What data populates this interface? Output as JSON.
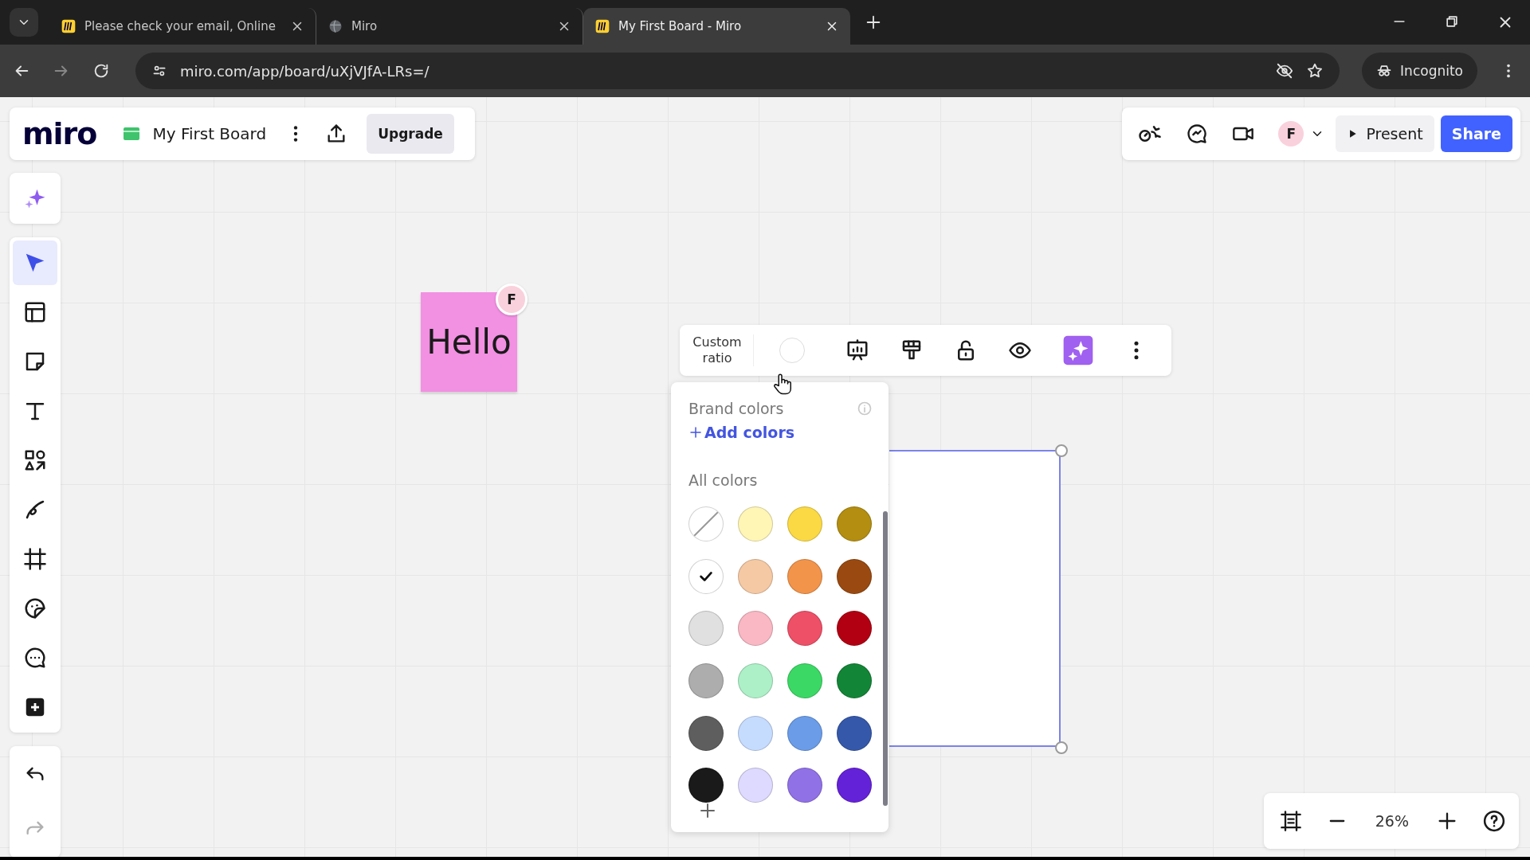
{
  "browser": {
    "tabs": [
      {
        "title": "Please check your email, Online",
        "kind": "miro",
        "selected": false
      },
      {
        "title": "Miro",
        "kind": "globe",
        "selected": false
      },
      {
        "title": "My First Board - Miro",
        "kind": "miro",
        "selected": true
      }
    ],
    "url": "miro.com/app/board/uXjVJfA-LRs=/",
    "profile": "Incognito"
  },
  "board_bar": {
    "logo": "miro",
    "title": "My First Board",
    "upgrade": "Upgrade"
  },
  "collab_bar": {
    "avatar": "F",
    "present": "Present",
    "share": "Share"
  },
  "tools": [
    {
      "kind": "select",
      "selected": true
    },
    {
      "kind": "templates",
      "selected": false
    },
    {
      "kind": "sticky",
      "selected": false
    },
    {
      "kind": "text",
      "selected": false
    },
    {
      "kind": "shapes",
      "selected": false
    },
    {
      "kind": "pen",
      "selected": false
    },
    {
      "kind": "frame",
      "selected": false
    },
    {
      "kind": "sticker",
      "selected": false
    },
    {
      "kind": "comment",
      "selected": false
    },
    {
      "kind": "more",
      "selected": false
    }
  ],
  "history": [
    {
      "kind": "undo",
      "disabled": false
    },
    {
      "kind": "redo",
      "disabled": true
    }
  ],
  "sticky": {
    "text": "Hello",
    "color": "#f290e2",
    "author": "F"
  },
  "context_toolbar": {
    "ratio": "Custom ratio",
    "actions": [
      {
        "kind": "present"
      },
      {
        "kind": "format"
      },
      {
        "kind": "unlock"
      },
      {
        "kind": "eye"
      },
      {
        "kind": "ai"
      },
      {
        "kind": "more"
      }
    ]
  },
  "color_panel": {
    "brand_title": "Brand colors",
    "add_colors": "Add colors",
    "all_title": "All colors",
    "swatches": [
      {
        "kind": "none",
        "selected": false
      },
      {
        "kind": "color",
        "color": "#fff6b6",
        "selected": false
      },
      {
        "kind": "color",
        "color": "#fad945",
        "selected": false
      },
      {
        "kind": "color",
        "color": "#b38e10",
        "selected": false
      },
      {
        "kind": "color",
        "color": "#ffffff",
        "selected": true
      },
      {
        "kind": "color",
        "color": "#f5c9a4",
        "selected": false
      },
      {
        "kind": "color",
        "color": "#f2944a",
        "selected": false
      },
      {
        "kind": "color",
        "color": "#9a4a10",
        "selected": false
      },
      {
        "kind": "color",
        "color": "#e0e0e0",
        "selected": false
      },
      {
        "kind": "color",
        "color": "#f9b8c4",
        "selected": false
      },
      {
        "kind": "color",
        "color": "#ee5068",
        "selected": false
      },
      {
        "kind": "color",
        "color": "#b20012",
        "selected": false
      },
      {
        "kind": "color",
        "color": "#adadad",
        "selected": false
      },
      {
        "kind": "color",
        "color": "#adf0c7",
        "selected": false
      },
      {
        "kind": "color",
        "color": "#3cd865",
        "selected": false
      },
      {
        "kind": "color",
        "color": "#138537",
        "selected": false
      },
      {
        "kind": "color",
        "color": "#5e5e5e",
        "selected": false
      },
      {
        "kind": "color",
        "color": "#c6dcff",
        "selected": false
      },
      {
        "kind": "color",
        "color": "#6b9ce8",
        "selected": false
      },
      {
        "kind": "color",
        "color": "#3558aa",
        "selected": false
      },
      {
        "kind": "color",
        "color": "#1a1a1a",
        "selected": false
      },
      {
        "kind": "color",
        "color": "#dedaff",
        "selected": false
      },
      {
        "kind": "color",
        "color": "#9171e6",
        "selected": false
      },
      {
        "kind": "color",
        "color": "#6422d8",
        "selected": false
      }
    ]
  },
  "zoom": {
    "level": "26%"
  }
}
